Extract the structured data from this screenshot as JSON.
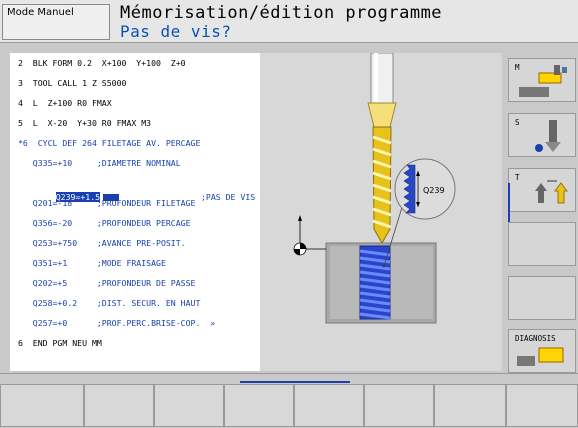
{
  "header": {
    "mode_label": "Mode Manuel",
    "title": "Mémorisation/édition programme",
    "subtitle": "Pas de vis?"
  },
  "program": {
    "lines": [
      "2  BLK FORM 0.2  X+100  Y+100  Z+0",
      "3  TOOL CALL 1 Z S5000",
      "4  L  Z+100 R0 FMAX",
      "5  L  X-20  Y+30 R0 FMAX M3",
      "*6  CYCL DEF 264 FILETAGE AV. PERCAGE",
      "   Q335=+10     ;DIAMETRE NOMINAL",
      "                ;PAS DE VIS",
      "   Q201=-18     ;PROFONDEUR FILETAGE",
      "   Q356=-20     ;PROFONDEUR PERCAGE",
      "   Q253=+750    ;AVANCE PRE-POSIT.",
      "   Q351=+1      ;MODE FRAISAGE",
      "   Q202=+5      ;PROFONDEUR DE PASSE",
      "   Q258=+0.2    ;DIST. SECUR. EN HAUT",
      "   Q257=+0      ;PROF.PERC.BRISE-COP.  »",
      "6  END PGM NEU MM"
    ],
    "highlight_value": "Q239=+1.5"
  },
  "graphic": {
    "callout_label": "Q239"
  },
  "softkeys_right": {
    "m_label": "M",
    "s_label": "S",
    "t_label": "T",
    "diagnosis_label": "DIAGNOSIS"
  },
  "colors": {
    "accent_blue": "#1a3fb0",
    "subtitle_blue": "#0a4fb6",
    "drill_yellow": "#e8c21a",
    "thread_blue": "#1e3fd0"
  }
}
